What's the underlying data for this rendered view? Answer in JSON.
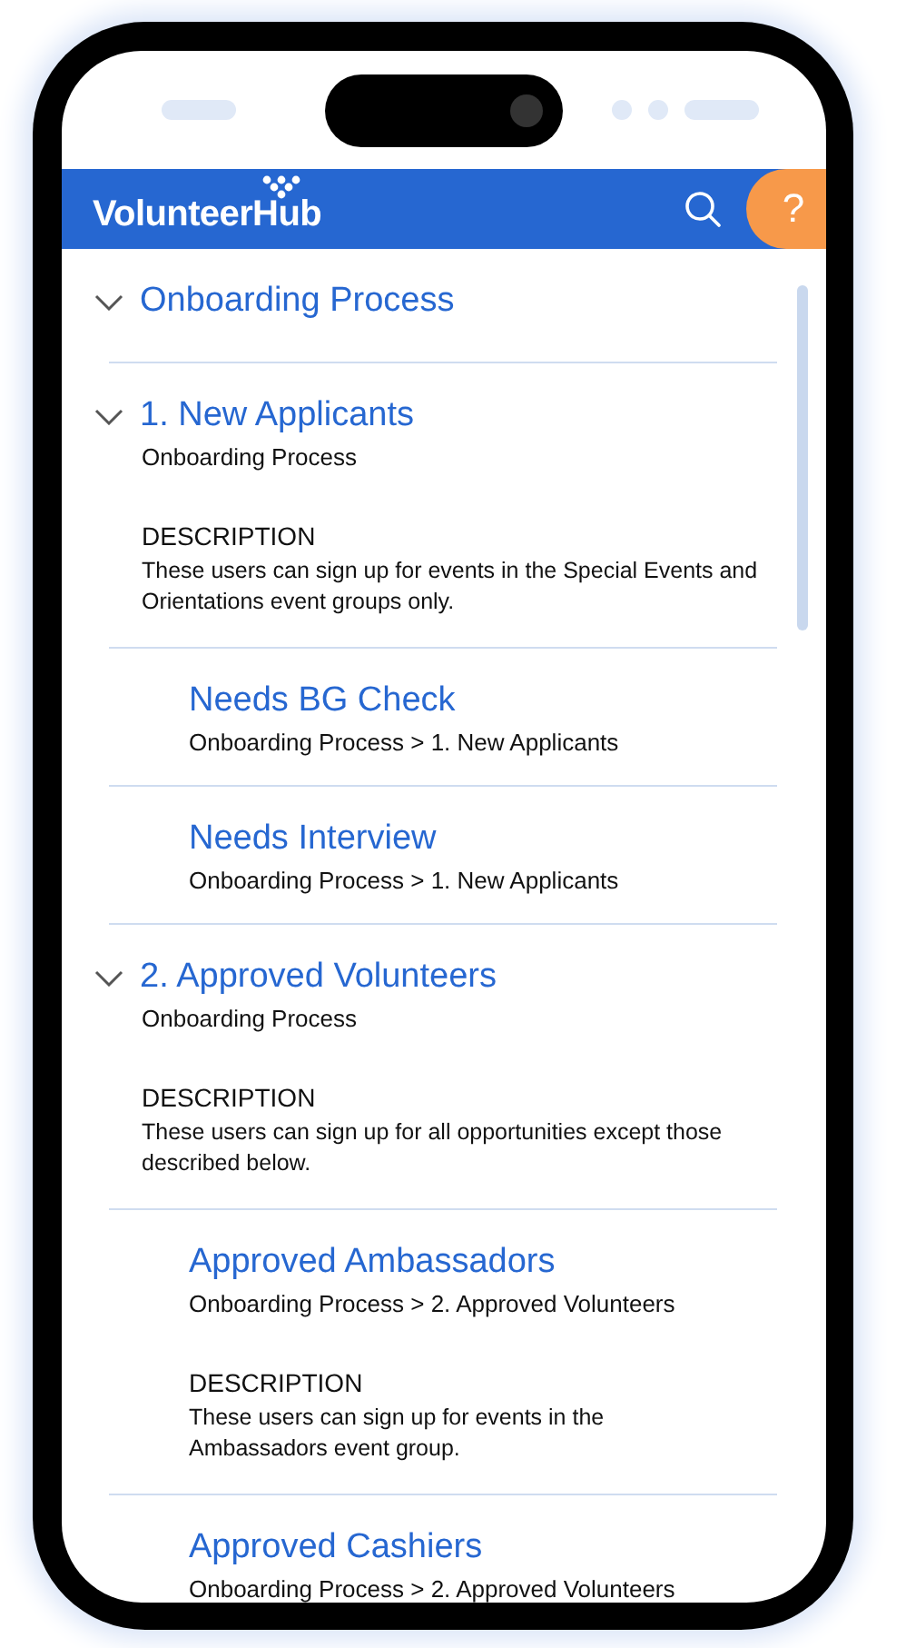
{
  "header": {
    "logo": "VolunteerHub",
    "help_label": "?"
  },
  "rows": [
    {
      "title": "Onboarding Process",
      "expanded": true
    },
    {
      "title": "1. New Applicants",
      "expanded": true,
      "path": "Onboarding Process",
      "description_label": "DESCRIPTION",
      "description": "These users can sign up for events in the Special Events and Orientations event groups only.",
      "children": [
        {
          "title": "Needs BG Check",
          "path": "Onboarding Process > 1. New Applicants"
        },
        {
          "title": "Needs Interview",
          "path": "Onboarding Process > 1. New Applicants"
        }
      ]
    },
    {
      "title": "2. Approved Volunteers",
      "expanded": true,
      "path": "Onboarding Process",
      "description_label": "DESCRIPTION",
      "description": "These users can sign up for all opportunities except those described below.",
      "children": [
        {
          "title": "Approved Ambassadors",
          "path": "Onboarding Process > 2. Approved Volunteers",
          "description_label": "DESCRIPTION",
          "description": "These users can sign up for events in the Ambassadors event group."
        },
        {
          "title": "Approved Cashiers",
          "path": "Onboarding Process > 2. Approved Volunteers"
        }
      ]
    }
  ]
}
